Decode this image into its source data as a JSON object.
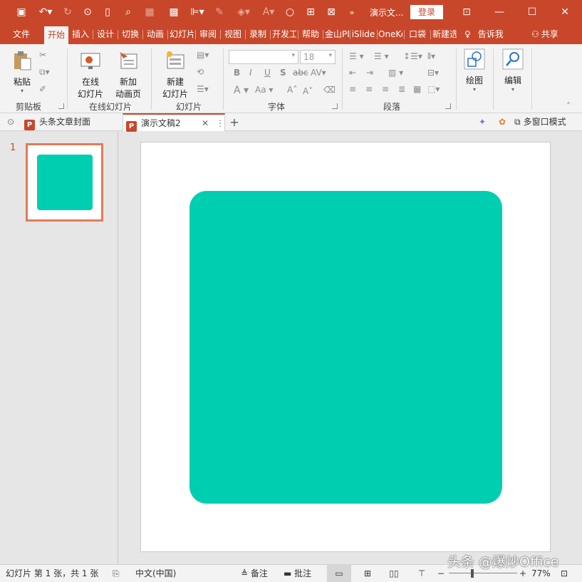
{
  "titlebar": {
    "document_title": "演示文...",
    "login_label": "登录",
    "minimize_glyph": "—",
    "maximize_glyph": "☐",
    "close_glyph": "✕",
    "ribbon_options_glyph": "⊡"
  },
  "quick_access": [
    {
      "name": "save-icon",
      "glyph": "💾"
    },
    {
      "name": "undo-icon",
      "glyph": "↶▾"
    },
    {
      "name": "redo-icon",
      "glyph": "↻"
    },
    {
      "name": "from-start-icon",
      "glyph": "▣"
    },
    {
      "name": "new-icon",
      "glyph": "▯"
    },
    {
      "name": "print-preview-icon",
      "glyph": "⌕"
    },
    {
      "name": "picture-icon",
      "glyph": "▦"
    },
    {
      "name": "grid-icon",
      "glyph": "▩"
    },
    {
      "name": "align-icon",
      "glyph": "⊫▾"
    },
    {
      "name": "eyedropper-icon",
      "glyph": "✎"
    },
    {
      "name": "fill-icon",
      "glyph": "◈▾"
    },
    {
      "name": "font-color-icon",
      "glyph": "A▾"
    },
    {
      "name": "oval-icon",
      "glyph": "○"
    },
    {
      "name": "crop-icon",
      "glyph": "⊞"
    },
    {
      "name": "more-icon",
      "glyph": "»"
    }
  ],
  "ribbon_tabs": [
    "文件",
    "开始",
    "插入",
    "设计",
    "切换",
    "动画",
    "幻灯片",
    "审阅",
    "视图",
    "录制",
    "开发工",
    "帮助",
    "金山PDF",
    "iSlide",
    "OneKey",
    "口袋",
    "新建选"
  ],
  "active_tab": "开始",
  "tell_me": "告诉我",
  "share": "共享",
  "ribbon": {
    "paste_label": "粘贴",
    "clipboard_group": "剪贴板",
    "online_slide_label_1": "在线",
    "online_slide_label_2": "幻灯片",
    "new_anim_page_label_1": "新加",
    "new_anim_page_label_2": "动画页",
    "online_group": "在线幻灯片",
    "new_slide_label_1": "新建",
    "new_slide_label_2": "幻灯片",
    "slides_group": "幻灯片",
    "font_size_value": "18",
    "font_group": "字体",
    "paragraph_group": "段落",
    "drawing_label": "绘图",
    "editing_label": "编辑"
  },
  "document_tabs": {
    "tab1": "头条文章封面",
    "tab2": "演示文稿2",
    "add_glyph": "+",
    "multi_window": "多窗口模式"
  },
  "slides": [
    {
      "number": "1",
      "shape_color": "#00ceb1"
    }
  ],
  "status": {
    "slide_info": "幻灯片 第 1 张，共 1 张",
    "language": "中文(中国)",
    "notes": "备注",
    "comments": "批注",
    "zoom_minus": "−",
    "zoom_plus": "+",
    "zoom_level": "77%"
  },
  "watermark": "头条 @爆炒Office",
  "colors": {
    "accent": "#c8472b",
    "shape": "#00ceb1",
    "thumb_border": "#e27b59"
  }
}
